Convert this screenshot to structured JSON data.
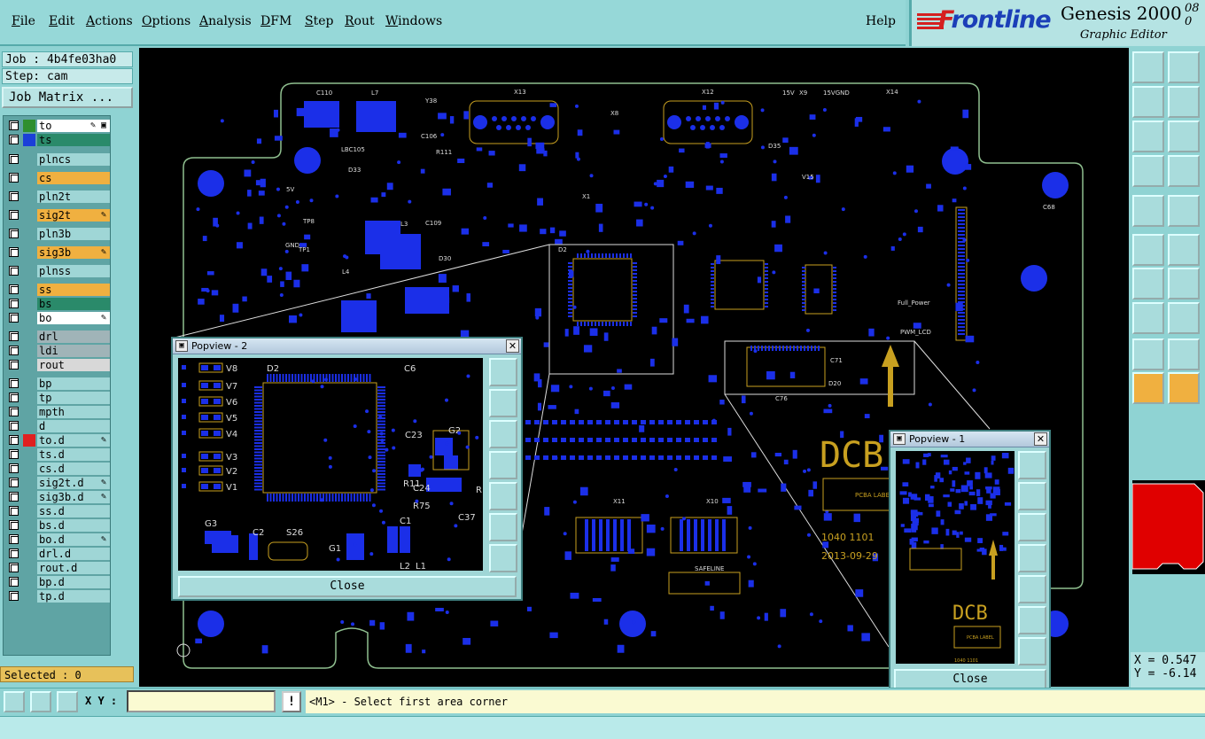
{
  "menu": [
    "File",
    "Edit",
    "Actions",
    "Options",
    "Analysis",
    "DFM",
    "Step",
    "Rout",
    "Windows"
  ],
  "help": "Help",
  "brand": {
    "name_prefix": "F",
    "name_rest": "rontline",
    "product": "Genesis 2000",
    "version": "08 0",
    "subtitle": "Graphic Editor"
  },
  "job": {
    "job_label": "Job : 4b4fe03ha0",
    "step_label": "Step: cam",
    "matrix_button": "Job Matrix ..."
  },
  "layers": [
    {
      "name": "to",
      "swatch": "#2f8f2f",
      "bg": "#ffffff",
      "mark": "✎ ▣"
    },
    {
      "name": "ts",
      "swatch": "#1b3fd8",
      "bg": "#2a8a6a",
      "mark": ""
    },
    {
      "name": "plncs",
      "swatch": "",
      "bg": "#9fd6d6",
      "mark": ""
    },
    {
      "name": "cs",
      "swatch": "",
      "bg": "#f0b040",
      "mark": ""
    },
    {
      "name": "pln2t",
      "swatch": "",
      "bg": "#9fd6d6",
      "mark": ""
    },
    {
      "name": "sig2t",
      "swatch": "",
      "bg": "#f0b040",
      "mark": "✎"
    },
    {
      "name": "pln3b",
      "swatch": "",
      "bg": "#9fd6d6",
      "mark": ""
    },
    {
      "name": "sig3b",
      "swatch": "",
      "bg": "#f0b040",
      "mark": "✎"
    },
    {
      "name": "plnss",
      "swatch": "",
      "bg": "#9fd6d6",
      "mark": ""
    },
    {
      "name": "ss",
      "swatch": "",
      "bg": "#f0b040",
      "mark": ""
    },
    {
      "name": "bs",
      "swatch": "",
      "bg": "#2a8a6a",
      "mark": ""
    },
    {
      "name": "bo",
      "swatch": "",
      "bg": "#ffffff",
      "mark": "✎"
    },
    {
      "name": "drl",
      "swatch": "",
      "bg": "#a0b4b8",
      "mark": ""
    },
    {
      "name": "ldi",
      "swatch": "",
      "bg": "#a0b4b8",
      "mark": ""
    },
    {
      "name": "rout",
      "swatch": "",
      "bg": "#d8d8d8",
      "mark": ""
    },
    {
      "name": "bp",
      "swatch": "",
      "bg": "#9fd6d6",
      "mark": ""
    },
    {
      "name": "tp",
      "swatch": "",
      "bg": "#9fd6d6",
      "mark": ""
    },
    {
      "name": "mpth",
      "swatch": "",
      "bg": "#9fd6d6",
      "mark": ""
    },
    {
      "name": "d",
      "swatch": "",
      "bg": "#9fd6d6",
      "mark": ""
    },
    {
      "name": "to.d",
      "swatch": "#e02020",
      "bg": "#9fd6d6",
      "mark": "✎"
    },
    {
      "name": "ts.d",
      "swatch": "",
      "bg": "#9fd6d6",
      "mark": ""
    },
    {
      "name": "cs.d",
      "swatch": "",
      "bg": "#9fd6d6",
      "mark": ""
    },
    {
      "name": "sig2t.d",
      "swatch": "",
      "bg": "#9fd6d6",
      "mark": "✎"
    },
    {
      "name": "sig3b.d",
      "swatch": "",
      "bg": "#9fd6d6",
      "mark": "✎"
    },
    {
      "name": "ss.d",
      "swatch": "",
      "bg": "#9fd6d6",
      "mark": ""
    },
    {
      "name": "bs.d",
      "swatch": "",
      "bg": "#9fd6d6",
      "mark": ""
    },
    {
      "name": "bo.d",
      "swatch": "",
      "bg": "#9fd6d6",
      "mark": "✎"
    },
    {
      "name": "drl.d",
      "swatch": "",
      "bg": "#9fd6d6",
      "mark": ""
    },
    {
      "name": "rout.d",
      "swatch": "",
      "bg": "#9fd6d6",
      "mark": ""
    },
    {
      "name": "bp.d",
      "swatch": "",
      "bg": "#9fd6d6",
      "mark": ""
    },
    {
      "name": "tp.d",
      "swatch": "",
      "bg": "#9fd6d6",
      "mark": ""
    }
  ],
  "selected": "Selected : 0",
  "board": {
    "labels": [
      "C110",
      "L7",
      "Y38",
      "X13",
      "X12",
      "X8",
      "X9",
      "X14",
      "15V",
      "15VGND",
      "C106",
      "LBC105",
      "X1",
      "DCB",
      "PCBA LABEL",
      "1040 1101",
      "2013-09-29",
      "X11",
      "X10",
      "SAFELINE",
      "Full_Power",
      "PWM_LCD",
      "D2",
      "D20",
      "C76",
      "C71",
      "TP8",
      "TP1",
      "GND",
      "5V",
      "D33",
      "L3",
      "L4",
      "C109",
      "D30",
      "R111",
      "V15",
      "D35",
      "C68"
    ]
  },
  "popview2": {
    "title": "Popview - 2",
    "close": "Close",
    "labels": [
      "V8",
      "V7",
      "V6",
      "V5",
      "V4",
      "V3",
      "V2",
      "V1",
      "D2",
      "C6",
      "C23",
      "G2",
      "R11",
      "C24",
      "R75",
      "C37",
      "G3",
      "C2",
      "S26",
      "G1",
      "C1",
      "L2",
      "L1",
      "R"
    ]
  },
  "popview1": {
    "title": "Popview - 1",
    "close": "Close",
    "labels": [
      "DCB",
      "PCBA LABEL",
      "1040 1101"
    ]
  },
  "coords": {
    "x": "X = 0.547",
    "y": "Y = -6.14"
  },
  "bottom": {
    "xy_label": "X Y :",
    "xy_value": "",
    "excl": "!",
    "prompt": "<M1> - Select first area corner"
  },
  "colors": {
    "board_outline": "#8fbf8f",
    "pad": "#1b2fe8",
    "silk": "#c8a020",
    "canvas": "#000000"
  }
}
